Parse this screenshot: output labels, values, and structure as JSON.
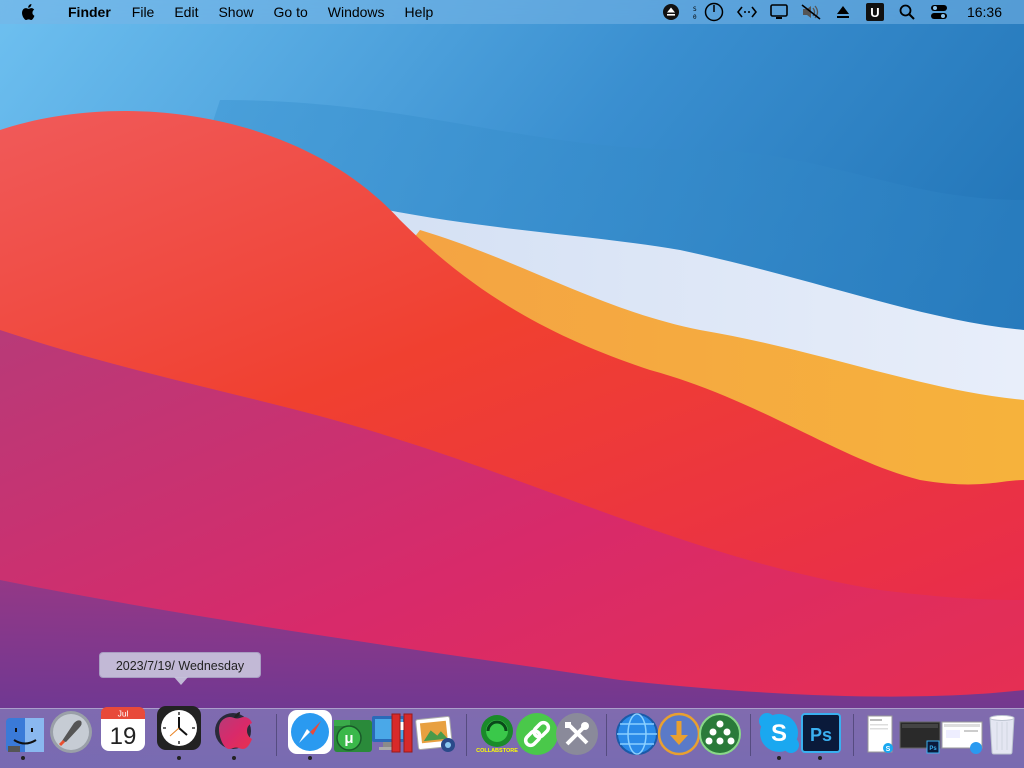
{
  "menubar": {
    "apple_icon": "apple-logo-icon",
    "app_name": "Finder",
    "items": [
      "File",
      "Edit",
      "Show",
      "Go to",
      "Windows",
      "Help"
    ],
    "status_icons": [
      "eject-icon",
      "timer-icon",
      "code-icon",
      "display-icon",
      "mute-icon",
      "upload-icon",
      "u-app-icon",
      "search-icon",
      "control-center-icon"
    ],
    "clock": "16:36"
  },
  "tooltip": {
    "text": "2023/7/19/ Wednesday"
  },
  "dock": {
    "calendar": {
      "month": "Jul",
      "day": "19"
    },
    "items": [
      "finder-icon",
      "launchpad-icon",
      "calendar-icon",
      "clock-icon",
      "macos-installer-icon",
      "safari-icon",
      "utorrent-icon",
      "remote-desktop-icon",
      "parallels-icon",
      "preview-icon",
      "collabstore-icon",
      "link-icon",
      "utilities-icon",
      "globe-icon",
      "download-icon",
      "cluster-icon",
      "skype-icon",
      "photoshop-icon",
      "window-thumbnail-1",
      "window-thumbnail-2",
      "window-thumbnail-3",
      "trash-icon"
    ],
    "photoshop_label": "Ps",
    "collab_label": "COLLABSTORE"
  },
  "colors": {
    "menubar_bg": "#8ec4ec",
    "dock_bg": "#8c96c8",
    "tooltip_bg": "#c8c4dc"
  }
}
